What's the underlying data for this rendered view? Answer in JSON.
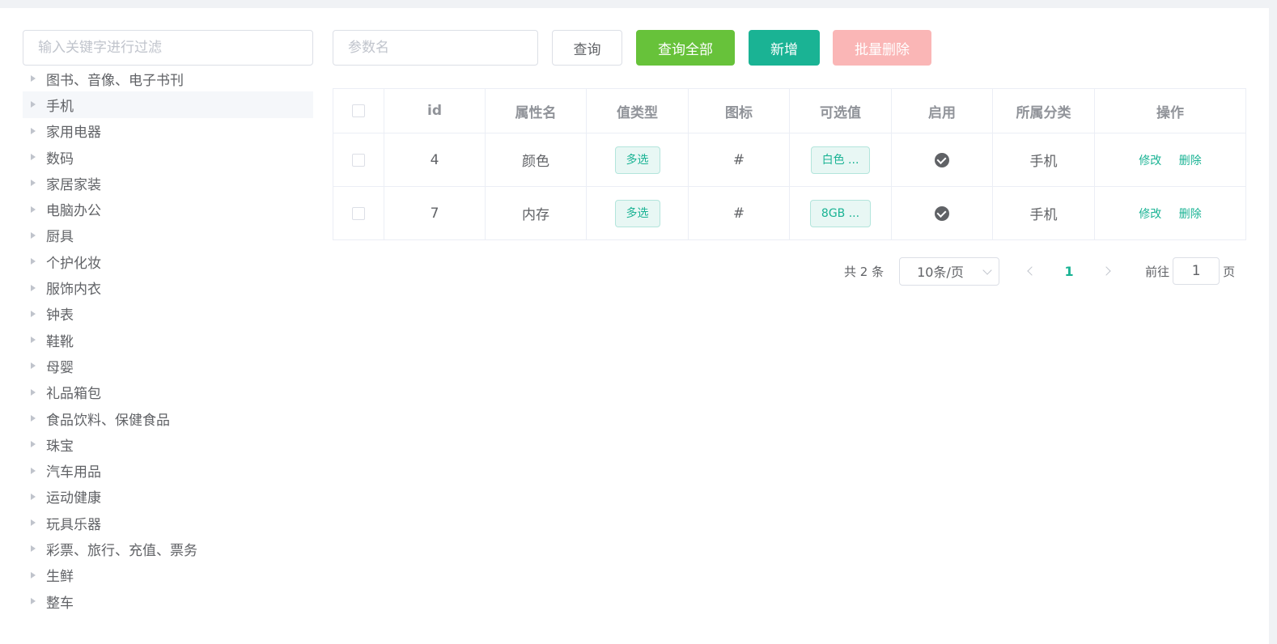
{
  "filter": {
    "placeholder": "输入关键字进行过滤"
  },
  "tree": {
    "items": [
      {
        "label": "图书、音像、电子书刊"
      },
      {
        "label": "手机"
      },
      {
        "label": "家用电器"
      },
      {
        "label": "数码"
      },
      {
        "label": "家居家装"
      },
      {
        "label": "电脑办公"
      },
      {
        "label": "厨具"
      },
      {
        "label": "个护化妆"
      },
      {
        "label": "服饰内衣"
      },
      {
        "label": "钟表"
      },
      {
        "label": "鞋靴"
      },
      {
        "label": "母婴"
      },
      {
        "label": "礼品箱包"
      },
      {
        "label": "食品饮料、保健食品"
      },
      {
        "label": "珠宝"
      },
      {
        "label": "汽车用品"
      },
      {
        "label": "运动健康"
      },
      {
        "label": "玩具乐器"
      },
      {
        "label": "彩票、旅行、充值、票务"
      },
      {
        "label": "生鲜"
      },
      {
        "label": "整车"
      }
    ],
    "current": "手机"
  },
  "toolbar": {
    "param_placeholder": "参数名",
    "search_label": "查询",
    "search_all_label": "查询全部",
    "add_label": "新增",
    "batch_delete_label": "批量删除"
  },
  "table": {
    "headers": [
      "id",
      "属性名",
      "值类型",
      "图标",
      "可选值",
      "启用",
      "所属分类",
      "操作"
    ],
    "rows": [
      {
        "id": "4",
        "name": "颜色",
        "type": "多选",
        "icon": "#",
        "values": "白色 ...",
        "enabled": true,
        "category": "手机",
        "edit": "修改",
        "delete": "删除"
      },
      {
        "id": "7",
        "name": "内存",
        "type": "多选",
        "icon": "#",
        "values": "8GB ...",
        "enabled": true,
        "category": "手机",
        "edit": "修改",
        "delete": "删除"
      }
    ]
  },
  "pagination": {
    "total": "共 2 条",
    "page_size": "10条/页",
    "current_page": "1",
    "goto_label": "前往",
    "goto_value": "1",
    "goto_suffix": "页"
  },
  "colors": {
    "primary": "#1ab394",
    "success": "#67c23a",
    "danger_disabled": "#fab6b6"
  }
}
